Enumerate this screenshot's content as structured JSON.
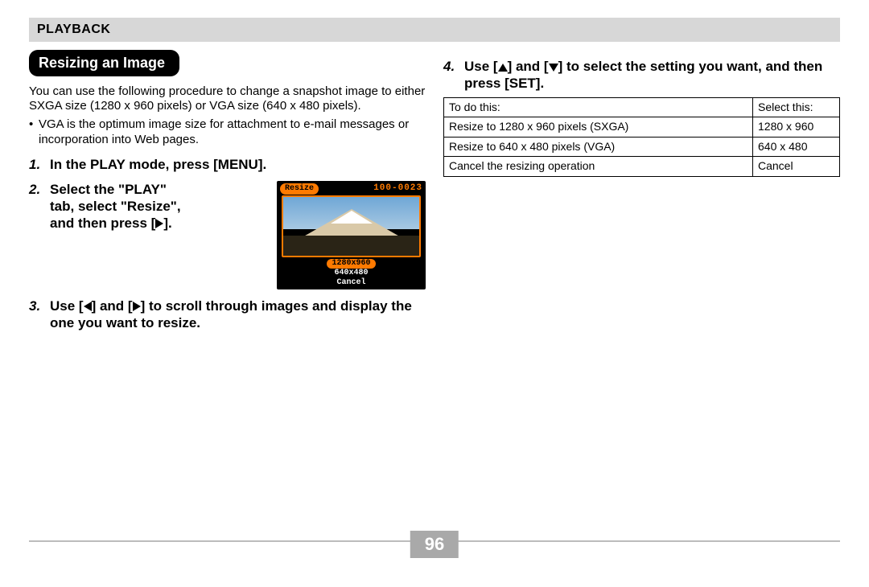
{
  "header": {
    "section": "PLAYBACK"
  },
  "left": {
    "title": "Resizing an Image",
    "intro": "You can use the following procedure to change a snapshot image to either SXGA size (1280 x 960 pixels) or VGA size (640 x 480 pixels).",
    "bullet": "VGA is the optimum image size for attachment to e-mail messages or incorporation into Web pages.",
    "step1_num": "1.",
    "step1": "In the PLAY mode, press [MENU].",
    "step2_num": "2.",
    "step2_a": "Select the \"PLAY\"",
    "step2_b": "tab, select \"Resize\",",
    "step2_c": "and then press [",
    "step2_d": "].",
    "step3_num": "3.",
    "step3_a": "Use [",
    "step3_b": "] and [",
    "step3_c": "] to scroll through images and display the one you want to resize."
  },
  "lcd": {
    "pill": "Resize",
    "folio": "100-0023",
    "opt1": "1280x960",
    "opt2": "640x480",
    "opt3": "Cancel"
  },
  "right": {
    "step4_num": "4.",
    "step4_a": "Use [",
    "step4_b": "] and [",
    "step4_c": "] to select the setting you want, and then press [SET].",
    "table": {
      "h1": "To do this:",
      "h2": "Select this:",
      "rows": [
        {
          "a": "Resize to 1280 x 960 pixels (SXGA)",
          "b": "1280 x 960"
        },
        {
          "a": "Resize to 640 x 480 pixels (VGA)",
          "b": "640 x 480"
        },
        {
          "a": "Cancel the resizing operation",
          "b": "Cancel"
        }
      ]
    }
  },
  "footer": {
    "page": "96"
  }
}
